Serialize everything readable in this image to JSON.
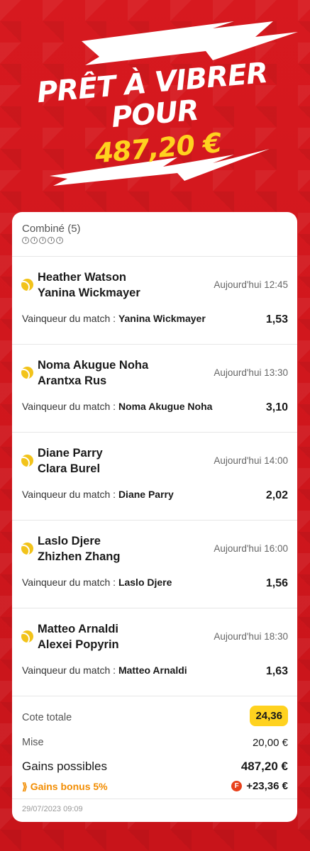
{
  "hero": {
    "line1": "PRÊT À VIBRER POUR",
    "line2": "487,20 €"
  },
  "bet": {
    "title": "Combiné (5)",
    "matches": [
      {
        "player1": "Heather Watson",
        "player2": "Yanina Wickmayer",
        "time": "Aujourd'hui 12:45",
        "market": "Vainqueur du match :",
        "selection": "Yanina Wickmayer",
        "odd": "1,53"
      },
      {
        "player1": "Noma Akugue Noha",
        "player2": "Arantxa Rus",
        "time": "Aujourd'hui 13:30",
        "market": "Vainqueur du match :",
        "selection": "Noma Akugue Noha",
        "odd": "3,10"
      },
      {
        "player1": "Diane Parry",
        "player2": "Clara Burel",
        "time": "Aujourd'hui 14:00",
        "market": "Vainqueur du match :",
        "selection": "Diane Parry",
        "odd": "2,02"
      },
      {
        "player1": "Laslo Djere",
        "player2": "Zhizhen Zhang",
        "time": "Aujourd'hui 16:00",
        "market": "Vainqueur du match :",
        "selection": "Laslo Djere",
        "odd": "1,56"
      },
      {
        "player1": "Matteo Arnaldi",
        "player2": "Alexei Popyrin",
        "time": "Aujourd'hui 18:30",
        "market": "Vainqueur du match :",
        "selection": "Matteo Arnaldi",
        "odd": "1,63"
      }
    ],
    "summary": {
      "total_odds_label": "Cote totale",
      "total_odds": "24,36",
      "stake_label": "Mise",
      "stake": "20,00 €",
      "gains_label": "Gains possibles",
      "gains": "487,20 €",
      "bonus_label": "Gains bonus 5%",
      "bonus": "+23,36 €"
    },
    "timestamp": "29/07/2023 09:09"
  },
  "colors": {
    "background": "#d21a1f",
    "accent_yellow": "#ffd21f",
    "bonus_orange": "#f28c00"
  }
}
